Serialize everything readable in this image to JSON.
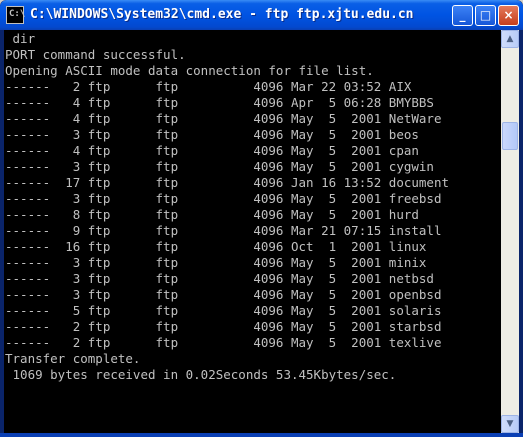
{
  "window": {
    "title": "C:\\WINDOWS\\System32\\cmd.exe - ftp ftp.xjtu.edu.cn",
    "icon_label": "C:\\",
    "minimize_symbol": "_",
    "maximize_symbol": "□",
    "close_symbol": "×"
  },
  "console": {
    "lines": [
      " dir",
      "PORT command successful.",
      "Opening ASCII mode data connection for file list.",
      "------   2 ftp      ftp          4096 Mar 22 03:52 AIX",
      "------   4 ftp      ftp          4096 Apr  5 06:28 BMYBBS",
      "------   4 ftp      ftp          4096 May  5  2001 NetWare",
      "------   3 ftp      ftp          4096 May  5  2001 beos",
      "------   4 ftp      ftp          4096 May  5  2001 cpan",
      "------   3 ftp      ftp          4096 May  5  2001 cygwin",
      "------  17 ftp      ftp          4096 Jan 16 13:52 document",
      "------   3 ftp      ftp          4096 May  5  2001 freebsd",
      "------   8 ftp      ftp          4096 May  5  2001 hurd",
      "------   9 ftp      ftp          4096 Mar 21 07:15 install",
      "------  16 ftp      ftp          4096 Oct  1  2001 linux",
      "------   3 ftp      ftp          4096 May  5  2001 minix",
      "------   3 ftp      ftp          4096 May  5  2001 netbsd",
      "------   3 ftp      ftp          4096 May  5  2001 openbsd",
      "------   5 ftp      ftp          4096 May  5  2001 solaris",
      "------   2 ftp      ftp          4096 May  5  2001 starbsd",
      "------   2 ftp      ftp          4096 May  5  2001 texlive",
      "Transfer complete.",
      " 1069 bytes received in 0.02Seconds 53.45Kbytes/sec."
    ]
  },
  "scrollbar": {
    "up_arrow": "▲",
    "down_arrow": "▼"
  },
  "colors": {
    "titlebar": "#0054e3",
    "console_bg": "#000000",
    "console_text": "#c0c0c0",
    "close_button": "#c63e1c"
  }
}
